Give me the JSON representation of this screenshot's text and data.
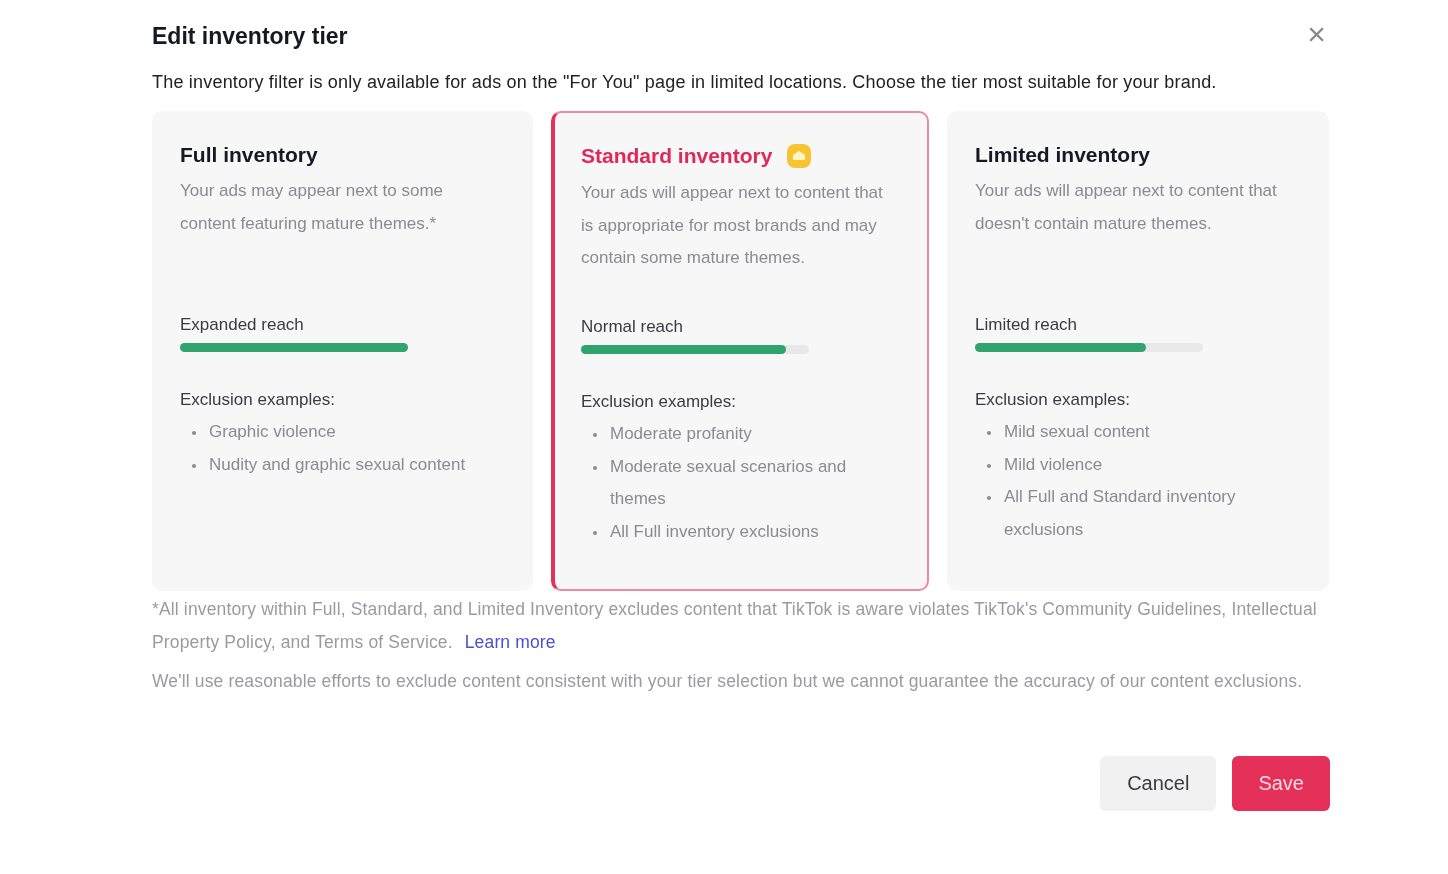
{
  "dialog": {
    "title": "Edit inventory tier",
    "close": "×",
    "description": "The inventory filter is only available for ads on the \"For You\" page in limited locations. Choose the tier most suitable for your brand."
  },
  "tiers": [
    {
      "title": "Full inventory",
      "selected": false,
      "badge": false,
      "description": "Your ads may appear next to some content featuring mature themes.*",
      "reach_label": "Expanded reach",
      "level": 1,
      "exclusions_title": "Exclusion examples:",
      "exclusions": [
        "Graphic violence",
        "Nudity and graphic sexual content"
      ]
    },
    {
      "title": "Standard inventory",
      "selected": true,
      "badge": true,
      "description": "Your ads will appear next to content that is appropriate for most brands and may contain some mature themes.",
      "reach_label": "Normal reach",
      "level": 0.9,
      "exclusions_title": "Exclusion examples:",
      "exclusions": [
        "Moderate profanity",
        "Moderate sexual scenarios and themes",
        "All Full inventory exclusions"
      ]
    },
    {
      "title": "Limited inventory",
      "selected": false,
      "badge": false,
      "description": "Your ads will appear next to content that doesn't contain mature themes.",
      "reach_label": "Limited reach",
      "level": 0.75,
      "exclusions_title": "Exclusion examples:",
      "exclusions": [
        "Mild sexual content",
        "Mild violence",
        "All Full and Standard inventory exclusions"
      ]
    }
  ],
  "footnote": {
    "text": "*All inventory within Full, Standard, and Limited Inventory excludes content that TikTok is aware violates TikTok's Community Guidelines, Intellectual Property Policy, and Terms of Service.",
    "link": "Learn more"
  },
  "disclaimer": "We'll use reasonable efforts to exclude content consistent with your tier selection but we cannot guarantee the accuracy of our content exclusions.",
  "buttons": [
    {
      "label": "Cancel",
      "kind": "secondary"
    },
    {
      "label": "Save",
      "kind": "primary"
    }
  ]
}
